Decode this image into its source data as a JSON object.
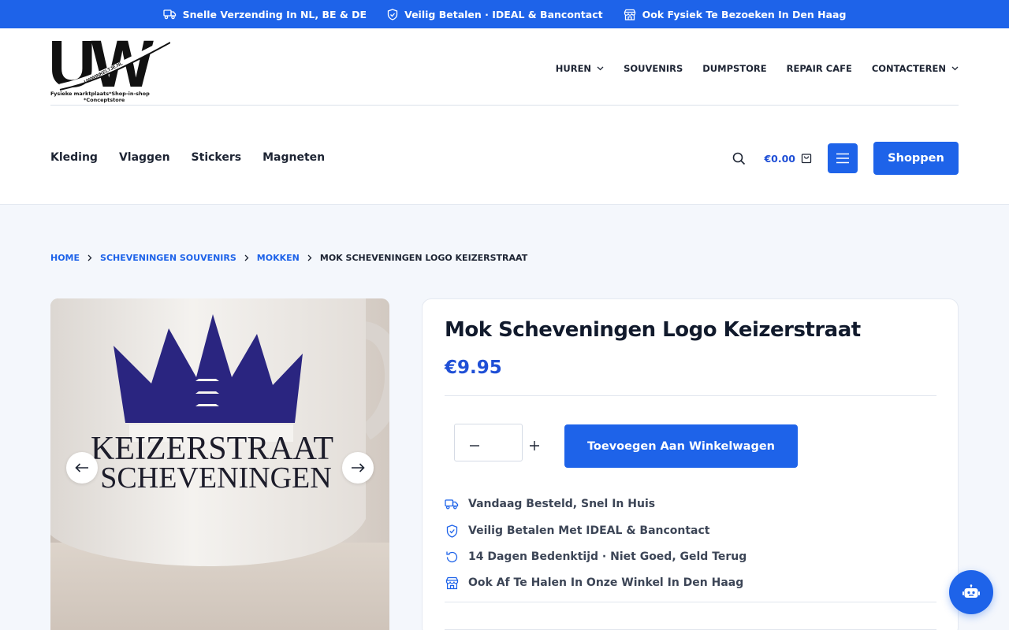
{
  "topbar": {
    "items": [
      {
        "icon": "truck-icon",
        "label": "Snelle Verzending In NL, BE & DE"
      },
      {
        "icon": "shield-check-icon",
        "label": "Veilig Betalen · IDEAL & Bancontact"
      },
      {
        "icon": "store-icon",
        "label": "Ook Fysiek Te Bezoeken In Den Haag"
      }
    ]
  },
  "logo": {
    "text": "UW",
    "ribbon": "UWWINKELTJE.NL",
    "tagline_1": "Fysieke marktplaats*Shop-in-shop",
    "tagline_2": "*Conceptstore"
  },
  "main_nav": {
    "huren": "HUREN",
    "souvenirs": "SOUVENIRS",
    "dumpstore": "DUMPSTORE",
    "repair_cafe": "REPAIR CAFE",
    "contacteren": "CONTACTEREN"
  },
  "category_nav": [
    "Kleding",
    "Vlaggen",
    "Stickers",
    "Magneten"
  ],
  "header_actions": {
    "cart_total": "€0.00",
    "shop_button": "Shoppen"
  },
  "breadcrumb": {
    "home": "HOME",
    "category": "SCHEVENINGEN SOUVENIRS",
    "subcategory": "MOKKEN",
    "current": "MOK SCHEVENINGEN LOGO KEIZERSTRAAT"
  },
  "gallery": {
    "mug_line_1": "KEIZERSTRAAT",
    "mug_line_2": "SCHEVENINGEN"
  },
  "product": {
    "title": "Mok Scheveningen Logo Keizerstraat",
    "price": "€9.95",
    "quantity": "",
    "add_to_cart": "Toevoegen Aan Winkelwagen",
    "features": [
      {
        "icon": "truck-icon",
        "label": "Vandaag Besteld, Snel In Huis"
      },
      {
        "icon": "shield-check-icon",
        "label": "Veilig Betalen Met IDEAL & Bancontact"
      },
      {
        "icon": "refresh-icon",
        "label": "14 Dagen Bedenktijd · Niet Goed, Geld Terug"
      },
      {
        "icon": "store-icon",
        "label": "Ook Af Te Halen In Onze Winkel In Den Haag"
      }
    ]
  },
  "colors": {
    "brand_blue": "#1e63e9",
    "price_blue": "#1f4fd6",
    "mug_print": "#2a2580"
  }
}
